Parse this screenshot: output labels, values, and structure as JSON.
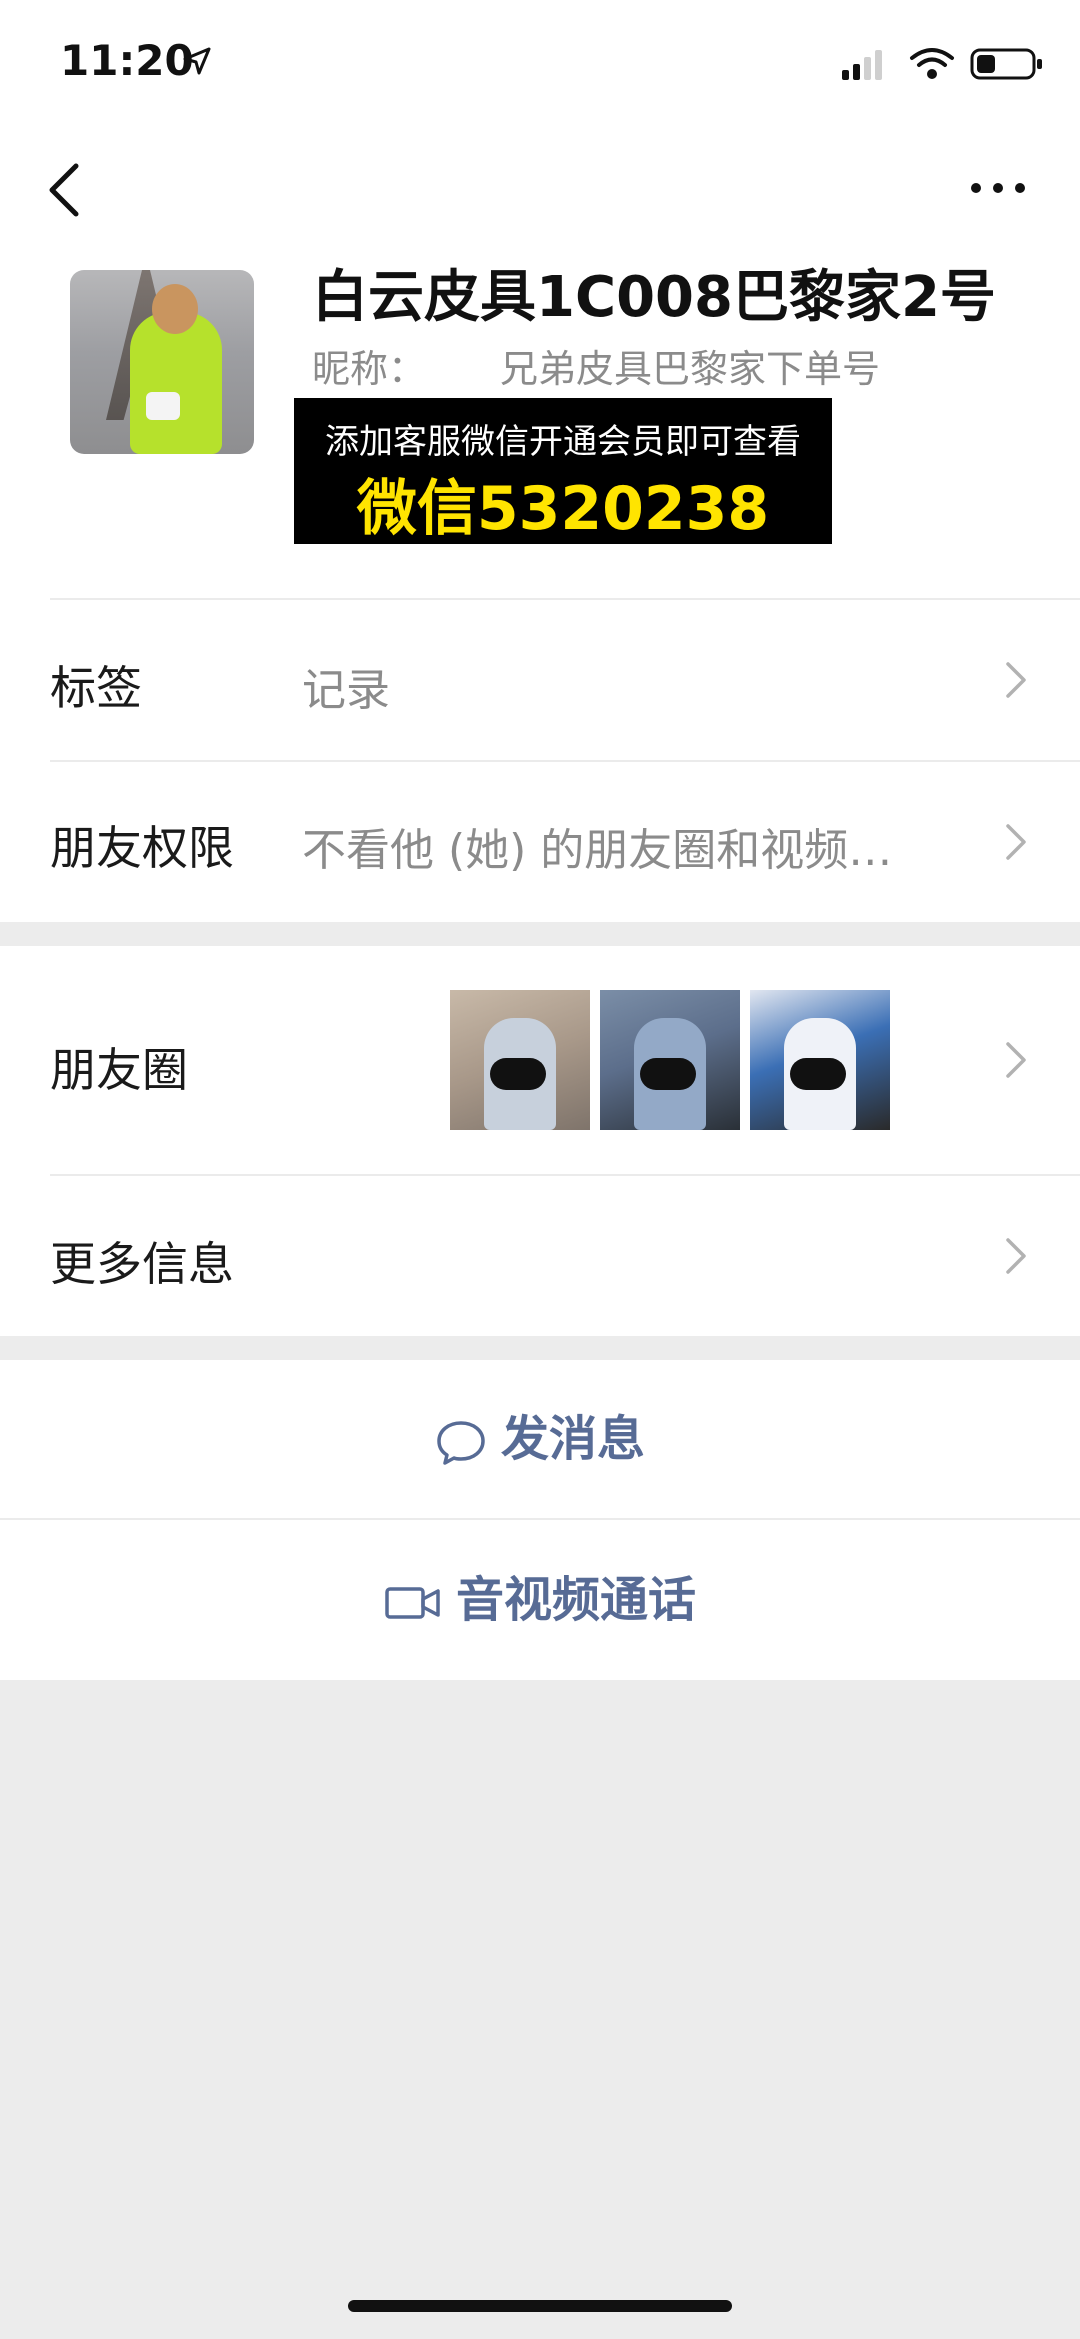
{
  "status_bar": {
    "time": "11:20",
    "icons": [
      "location-arrow-icon",
      "signal-icon",
      "wifi-icon",
      "battery-icon"
    ]
  },
  "nav": {
    "back_icon": "chevron-left-icon",
    "more_icon": "more-dots-icon"
  },
  "profile": {
    "name": "白云皮具1C008巴黎家2号",
    "nickname_label": "昵称：",
    "nickname_value": "兄弟皮具巴黎家下单号"
  },
  "promo_overlay": {
    "line1": "添加客服微信开通会员即可查看",
    "line2": "微信5320238",
    "text_color": "#ffe400",
    "background": "#000000"
  },
  "rows": {
    "tags": {
      "label": "标签",
      "value": "记录"
    },
    "permissions": {
      "label": "朋友权限",
      "value": "不看他 (她) 的朋友圈和视频…"
    },
    "moments": {
      "label": "朋友圈",
      "thumbnails": 3
    },
    "more_info": {
      "label": "更多信息"
    }
  },
  "actions": {
    "message": {
      "label": "发消息",
      "icon": "chat-bubble-icon"
    },
    "call": {
      "label": "音视频通话",
      "icon": "video-camera-icon"
    }
  },
  "colors": {
    "action": "#576b95",
    "secondary_text": "#8b8b8b",
    "background": "#ececec"
  }
}
